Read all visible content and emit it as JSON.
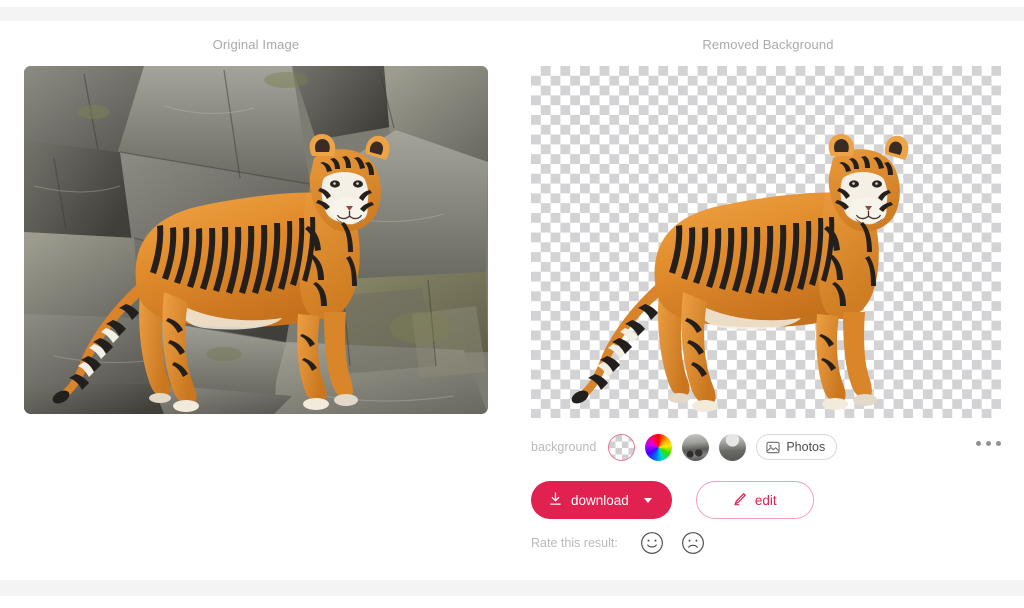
{
  "panels": {
    "left_caption": "Original Image",
    "right_caption": "Removed Background"
  },
  "background_chooser": {
    "label": "background",
    "swatches": [
      {
        "name": "transparent",
        "selected": true
      },
      {
        "name": "color-wheel",
        "selected": false
      },
      {
        "name": "photo-rocks",
        "selected": false
      },
      {
        "name": "photo-landscape",
        "selected": false
      }
    ],
    "photos_button": {
      "label": "Photos",
      "icon": "image-icon"
    },
    "more_menu": {
      "icon": "ellipsis-icon"
    }
  },
  "actions": {
    "download_label": "download",
    "download_icon": "download-arrow-icon",
    "download_caret": "chevron-down-icon",
    "edit_label": "edit",
    "edit_icon": "pencil-icon"
  },
  "rating": {
    "label": "Rate this result:",
    "positive_icon": "smiley-happy-icon",
    "negative_icon": "smiley-sad-icon"
  },
  "colors": {
    "accent": "#e1214f",
    "accent_soft": "#f2a2b6",
    "muted_text": "#b9babd",
    "caption_text": "#a9aaad",
    "chrome_band": "#f4f4f5",
    "checker": "#d3d3d5"
  },
  "images": {
    "original": {
      "subject": "tiger",
      "scene": "rocky-cliff"
    },
    "result": {
      "subject": "tiger",
      "scene": "transparent"
    }
  }
}
